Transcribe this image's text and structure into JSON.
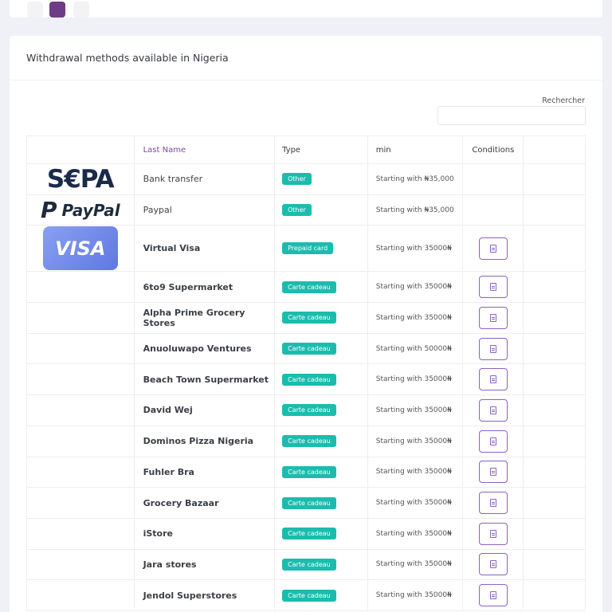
{
  "card": {
    "title": "Withdrawal methods available in Nigeria"
  },
  "search": {
    "label": "Rechercher",
    "placeholder": ""
  },
  "table": {
    "headers": {
      "logo": "",
      "name": "Last Name",
      "type": "Type",
      "min": "min",
      "conditions": "Conditions"
    },
    "rows": [
      {
        "logo": "S€PA",
        "name": "Bank transfer",
        "type": "Other",
        "min": "Starting with ₦35,000"
      },
      {
        "logo": "PayPal",
        "logo_mark": "P",
        "name": "Paypal",
        "type": "Other",
        "min": "Starting with ₦35,000"
      },
      {
        "logo": "VISA",
        "name": "Virtual Visa",
        "type": "Prepaid card",
        "min": "Starting with 35000₦"
      },
      {
        "name": "6to9 Supermarket",
        "type": "Carte cadeau",
        "min": "Starting with 35000₦"
      },
      {
        "name": "Alpha Prime Grocery Stores",
        "type": "Carte cadeau",
        "min": "Starting with 35000₦"
      },
      {
        "name": "Anuoluwapo Ventures",
        "type": "Carte cadeau",
        "min": "Starting with 50000₦"
      },
      {
        "name": "Beach Town Supermarket",
        "type": "Carte cadeau",
        "min": "Starting with 35000₦"
      },
      {
        "name": "David Wej",
        "type": "Carte cadeau",
        "min": "Starting with 35000₦"
      },
      {
        "name": "Dominos Pizza Nigeria",
        "type": "Carte cadeau",
        "min": "Starting with 35000₦"
      },
      {
        "name": "Fuhler Bra",
        "type": "Carte cadeau",
        "min": "Starting with 35000₦"
      },
      {
        "name": "Grocery Bazaar",
        "type": "Carte cadeau",
        "min": "Starting with 35000₦"
      },
      {
        "name": "iStore",
        "type": "Carte cadeau",
        "min": "Starting with 35000₦"
      },
      {
        "name": "Jara stores",
        "type": "Carte cadeau",
        "min": "Starting with 35000₦"
      },
      {
        "name": "Jendol Superstores",
        "type": "Carte cadeau",
        "min": "Starting with 35000₦"
      }
    ]
  },
  "colors": {
    "accent": "#6e3b86",
    "badge": "#1bbcae",
    "condition_border": "#8b62c2"
  },
  "icons": {
    "condition": "document-icon"
  }
}
